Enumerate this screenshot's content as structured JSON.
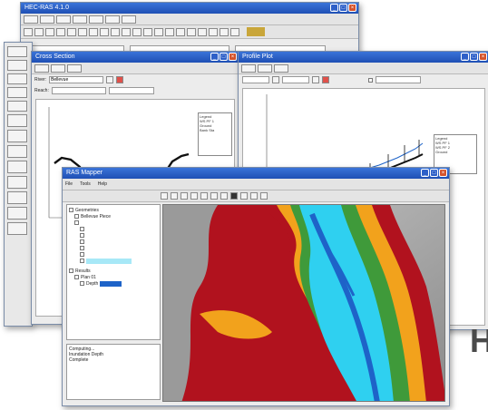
{
  "main_window": {
    "title": "HEC-RAS 4.1.0"
  },
  "cross_section_window": {
    "title": "Cross Section",
    "river_label": "River:",
    "reach_label": "Reach:",
    "river_value": "Bellevue",
    "legend_items": [
      "Legend",
      "WS PF 1",
      "Ground",
      "Bank Sta"
    ]
  },
  "profile_window": {
    "title": "Profile Plot",
    "legend_items": [
      "Legend",
      "WS PF 1",
      "WS PF 2",
      "Ground"
    ]
  },
  "ras_mapper_window": {
    "title": "RAS Mapper",
    "menu": [
      "File",
      "Tools",
      "Help"
    ],
    "tree_items": [
      "Geometries",
      "Bellevue Piece",
      "Results",
      "Plan 01",
      "Depth"
    ],
    "log_lines": [
      "Computing...",
      "Inundation Depth",
      "Complete"
    ]
  },
  "side_letter": "H",
  "colors": {
    "titlebar": "#1f4fb4",
    "water_cyan": "#2fd0f0",
    "water_blue": "#1e63c8",
    "terrain_red": "#b1121e",
    "terrain_orange": "#f2a21c",
    "terrain_green": "#3f9a3a",
    "terrain_gray": "#a8a8a8"
  }
}
